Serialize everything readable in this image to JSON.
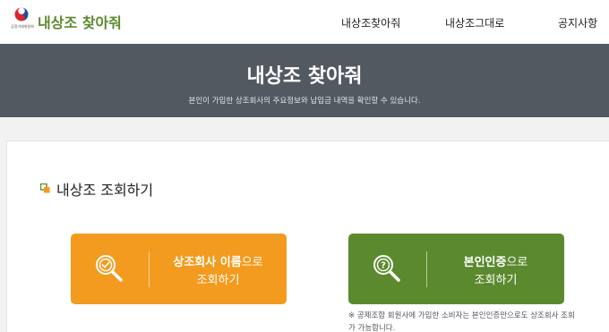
{
  "header": {
    "logo_caption": "공정거래위원회",
    "brand": "내상조 찾아줘",
    "nav": [
      "내상조찾아줘",
      "내상조그대로",
      "공지사항"
    ]
  },
  "banner": {
    "title": "내상조 찾아줘",
    "subtitle": "본인이 가입한 상조회사의 주요정보와 납입금 내역을 확인할 수 있습니다."
  },
  "section": {
    "title": "내상조 조회하기"
  },
  "buttons": {
    "company": {
      "bold": "상조회사 이름",
      "suffix": "으로",
      "line2": "조회하기",
      "icon": "magnifier-check-icon"
    },
    "identity": {
      "bold": "본인인증",
      "suffix": "으로",
      "line2": "조회하기",
      "icon": "magnifier-question-icon"
    }
  },
  "note": "※ 공제조합 회원사에 가입한 소비자는 본인인증만으로도 상조회사 조회가 가능합니다.",
  "colors": {
    "brand_green": "#5b8a2e",
    "orange": "#f29b1e",
    "banner_gray": "#535961"
  }
}
